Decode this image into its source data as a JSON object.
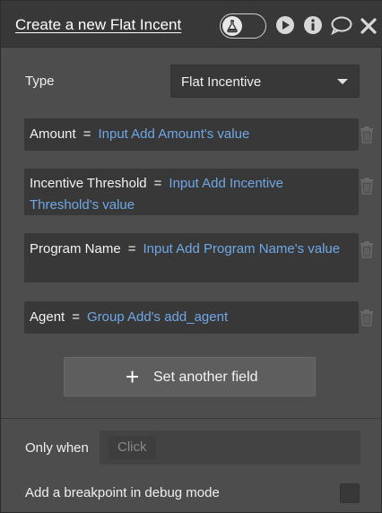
{
  "header": {
    "title": "Create a new Flat Incent",
    "icons": [
      "flask-icon",
      "play-icon",
      "info-icon",
      "comment-icon",
      "close-icon"
    ]
  },
  "type_row": {
    "label": "Type",
    "selected": "Flat Incentive"
  },
  "fields": [
    {
      "name": "Amount",
      "eq": "=",
      "value": "Input Add Amount's value"
    },
    {
      "name": "Incentive Threshold",
      "eq": "=",
      "value": "Input Add Incentive Threshold's value"
    },
    {
      "name": "Program Name",
      "eq": "=",
      "value": "Input Add Program Name's value"
    },
    {
      "name": "Agent",
      "eq": "=",
      "value": "Group Add's add_agent"
    }
  ],
  "set_field_button": {
    "icon": "+",
    "label": "Set another field"
  },
  "only_when": {
    "label": "Only when",
    "placeholder": "Click"
  },
  "breakpoint": {
    "label": "Add a breakpoint in debug mode",
    "checked": false
  },
  "colors": {
    "panel": "#4d4d4d",
    "header": "#383838",
    "input": "#383838",
    "link": "#6fa8e6"
  }
}
